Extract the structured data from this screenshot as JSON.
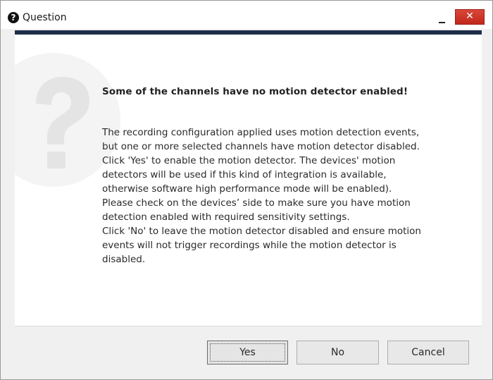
{
  "window": {
    "title": "Question",
    "icon": "question-circle-icon",
    "minimize_glyph": "minimize-icon",
    "close_glyph": "✕",
    "accent_color": "#1e2e4a",
    "close_color": "#c42b1c"
  },
  "dialog": {
    "watermark_icon": "question-mark-icon",
    "heading": "Some of the channels have no motion detector enabled!",
    "message_lines": [
      "The recording configuration applied uses motion detection events,",
      "but one or more selected channels have motion detector disabled.",
      "Click 'Yes' to enable the motion detector. The devices' motion",
      "detectors will be used if this kind of integration is available,",
      "otherwise software high performance mode will be enabled).",
      "Please check on the devices’ side to make sure you have motion",
      "detection enabled with required sensitivity settings.",
      "Click 'No' to leave the motion detector disabled and ensure motion",
      "events will not trigger recordings while the motion detector is",
      "disabled."
    ]
  },
  "buttons": {
    "yes": "Yes",
    "no": "No",
    "cancel": "Cancel"
  }
}
